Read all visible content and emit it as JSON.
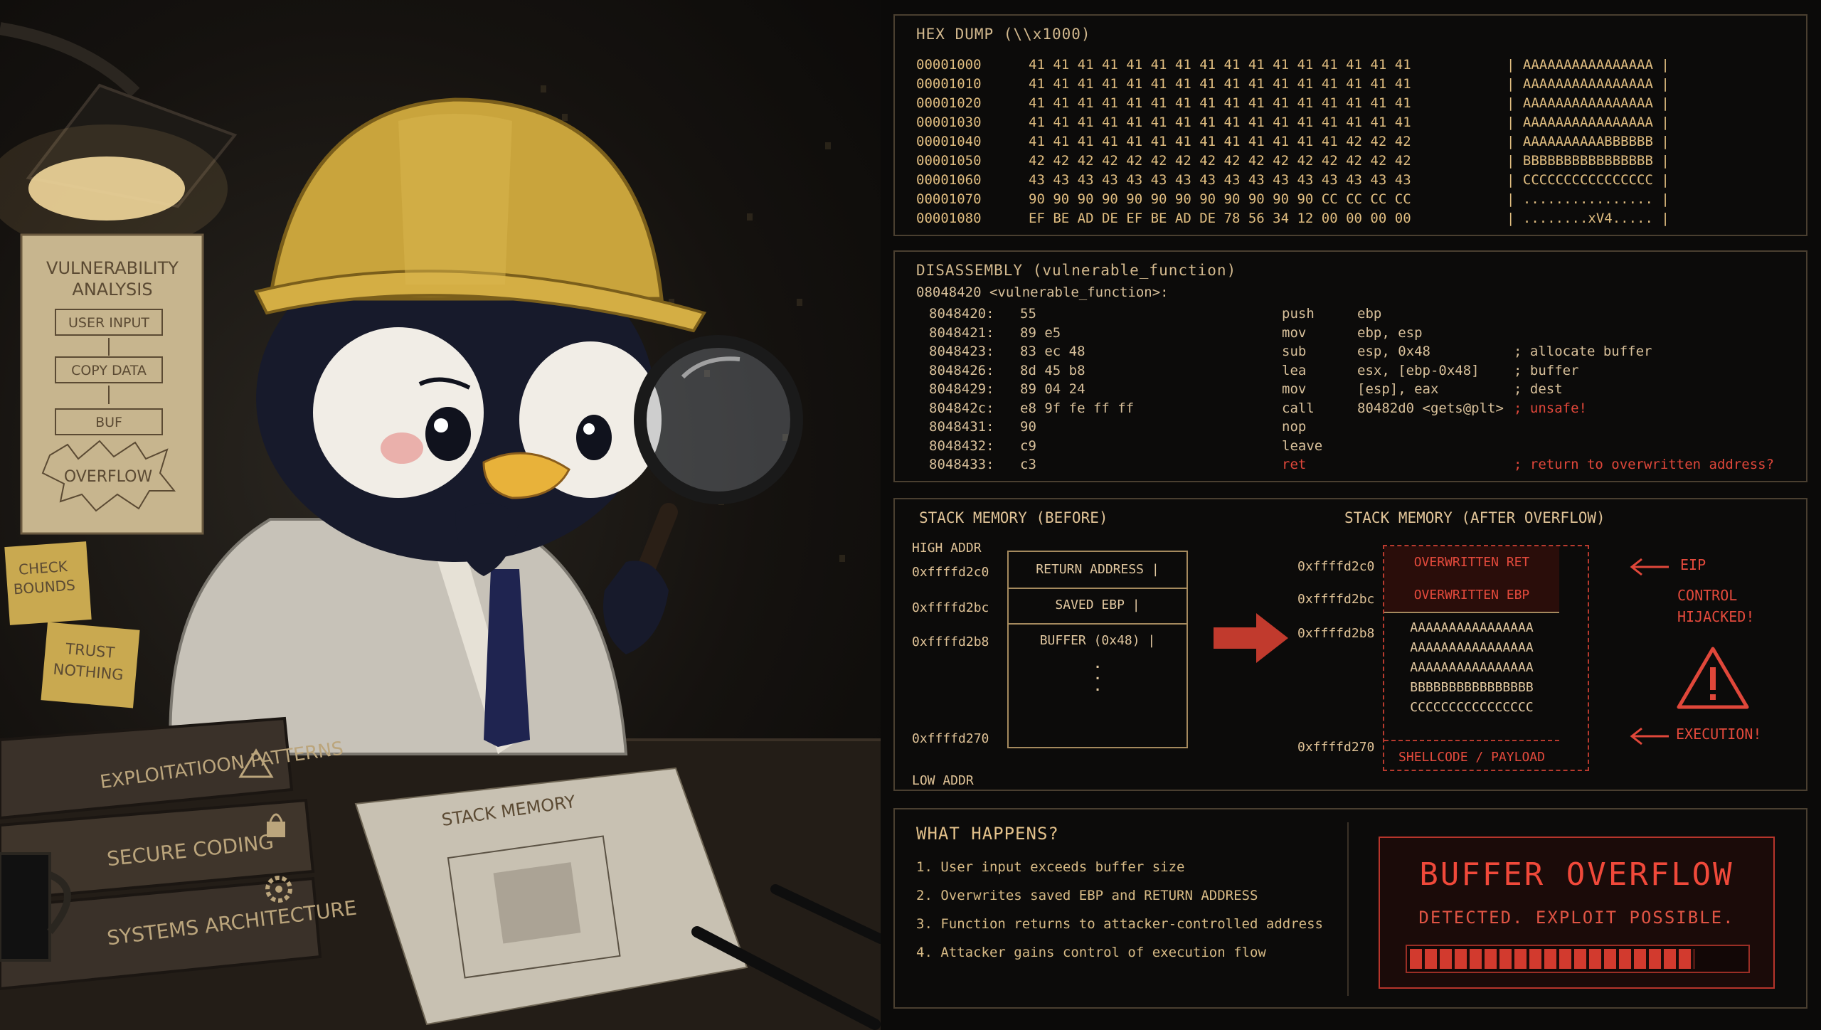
{
  "illustration": {
    "sign_title": "VULNERABILITY\nANALYSIS",
    "sign_flow": [
      "USER INPUT",
      "COPY DATA",
      "BUF",
      "OVERFLOW"
    ],
    "note_check": "CHECK\nBOUNDS",
    "note_trust": "TRUST\nNOTHING",
    "books": [
      "EXPLOITATIOON PATTERNS",
      "SECURE CODING",
      "SYSTEMS ARCHITECTURE"
    ],
    "paper_title": "STACK MEMORY",
    "icons": [
      "lamp-icon",
      "penguin-mascot",
      "magnifying-glass-icon",
      "warning-icon",
      "lock-icon",
      "gear-icon",
      "pen-icon",
      "mug-icon"
    ]
  },
  "hex_dump": {
    "title": "HEX DUMP (\\\\x1000)",
    "rows": [
      {
        "addr": "00001000",
        "bytes": "41 41 41 41 41 41 41 41 41 41 41 41 41 41 41 41",
        "ascii": "| AAAAAAAAAAAAAAAA |"
      },
      {
        "addr": "00001010",
        "bytes": "41 41 41 41 41 41 41 41 41 41 41 41 41 41 41 41",
        "ascii": "| AAAAAAAAAAAAAAAA |"
      },
      {
        "addr": "00001020",
        "bytes": "41 41 41 41 41 41 41 41 41 41 41 41 41 41 41 41",
        "ascii": "| AAAAAAAAAAAAAAAA |"
      },
      {
        "addr": "00001030",
        "bytes": "41 41 41 41 41 41 41 41 41 41 41 41 41 41 41 41",
        "ascii": "| AAAAAAAAAAAAAAAA |"
      },
      {
        "addr": "00001040",
        "bytes": "41 41 41 41 41 41 41 41 41 41 41 41 41 42 42 42",
        "ascii": "| AAAAAAAAAABBBBBB |"
      },
      {
        "addr": "00001050",
        "bytes": "42 42 42 42 42 42 42 42 42 42 42 42 42 42 42 42",
        "ascii": "| BBBBBBBBBBBBBBBB |"
      },
      {
        "addr": "00001060",
        "bytes": "43 43 43 43 43 43 43 43 43 43 43 43 43 43 43 43",
        "ascii": "| CCCCCCCCCCCCCCCC |"
      },
      {
        "addr": "00001070",
        "bytes": "90 90 90 90 90 90 90 90 90 90 90 90 CC CC CC CC",
        "ascii": "| ................ |"
      },
      {
        "addr": "00001080",
        "bytes": "EF BE AD DE EF BE AD DE 78 56 34 12 00 00 00 00",
        "ascii": "| ........xV4..... |"
      }
    ]
  },
  "disassembly": {
    "title": "DISASSEMBLY (vulnerable_function)",
    "header": "08048420 <vulnerable_function>:",
    "rows": [
      {
        "addr": "8048420:",
        "bytes": "55",
        "op": "push",
        "args": "ebp",
        "comment": ""
      },
      {
        "addr": "8048421:",
        "bytes": "89 e5",
        "op": "mov",
        "args": "ebp, esp",
        "comment": ""
      },
      {
        "addr": "8048423:",
        "bytes": "83 ec 48",
        "op": "sub",
        "args": "esp, 0x48",
        "comment": "; allocate buffer"
      },
      {
        "addr": "8048426:",
        "bytes": "8d 45 b8",
        "op": "lea",
        "args": "esx, [ebp-0x48]",
        "comment": "; buffer"
      },
      {
        "addr": "8048429:",
        "bytes": "89 04 24",
        "op": "mov",
        "args": "[esp], eax",
        "comment": "; dest"
      },
      {
        "addr": "804842c:",
        "bytes": "e8 9f fe ff ff",
        "op": "call",
        "args": "80482d0 <gets@plt>",
        "comment": "; unsafe!"
      },
      {
        "addr": "8048431:",
        "bytes": "90",
        "op": "nop",
        "args": "",
        "comment": ""
      },
      {
        "addr": "8048432:",
        "bytes": "c9",
        "op": "leave",
        "args": "",
        "comment": ""
      },
      {
        "addr": "8048433:",
        "bytes": "c3",
        "op": "ret",
        "args": "",
        "comment": "; return to overwritten address?"
      }
    ]
  },
  "stack": {
    "before": {
      "title": "STACK MEMORY (BEFORE)",
      "high": "HIGH ADDR",
      "low": "LOW ADDR",
      "addrs": [
        "0xffffd2c0",
        "0xffffd2bc",
        "0xffffd2b8",
        "0xffffd270"
      ],
      "slots": [
        "RETURN ADDRESS |",
        "SAVED EBP |",
        "BUFFER (0x48) |"
      ],
      "dots": ".\n.\n."
    },
    "after": {
      "title": "STACK MEMORY (AFTER OVERFLOW)",
      "addrs": [
        "0xffffd2c0",
        "0xffffd2bc",
        "0xffffd2b8",
        "0xffffd270"
      ],
      "slots": [
        "OVERWRITTEN RET",
        "OVERWRITTEN EBP",
        "SHELLCODE / PAYLOAD"
      ],
      "fill": [
        "AAAAAAAAAAAAAAAA",
        "AAAAAAAAAAAAAAAA",
        "AAAAAAAAAAAAAAAA",
        "BBBBBBBBBBBBBBBB",
        "CCCCCCCCCCCCCCCC"
      ],
      "eip": "EIP",
      "control": "CONTROL\nHIJACKED!",
      "execution": "EXECUTION!"
    }
  },
  "what_happens": {
    "title": "WHAT HAPPENS?",
    "steps": [
      "1. User input exceeds buffer size",
      "2. Overwrites saved EBP and RETURN ADDRESS",
      "3. Function returns to attacker-controlled address",
      "4. Attacker gains control of execution flow"
    ]
  },
  "alarm": {
    "title": "BUFFER OVERFLOW",
    "subtitle": "DETECTED. EXPLOIT POSSIBLE.",
    "progress": 0.85
  },
  "colors": {
    "accent": "#e0473a",
    "amber": "#d7ba85",
    "border": "#4a3f30"
  }
}
